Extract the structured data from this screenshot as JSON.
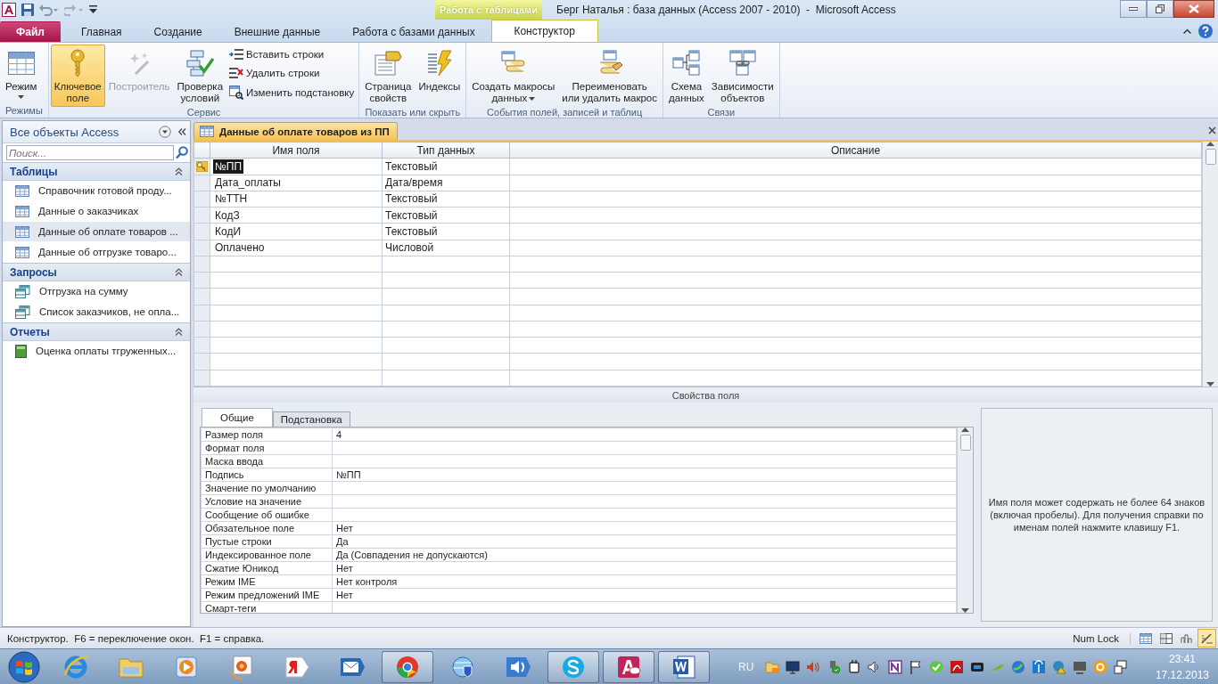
{
  "window": {
    "title": "Берг Наталья : база данных (Access 2007 - 2010)  -  Microsoft Access",
    "contextual_group": "Работа с таблицами"
  },
  "ribbon_tabs": [
    {
      "label": "Файл",
      "kind": "file",
      "selected": false
    },
    {
      "label": "Главная",
      "kind": "tab",
      "selected": false
    },
    {
      "label": "Создание",
      "kind": "tab",
      "selected": false
    },
    {
      "label": "Внешние данные",
      "kind": "tab",
      "selected": false
    },
    {
      "label": "Работа с базами данных",
      "kind": "tab",
      "selected": false
    },
    {
      "label": "Конструктор",
      "kind": "tab",
      "selected": true
    }
  ],
  "ribbon_groups": [
    {
      "label": "Режимы",
      "buttons": [
        {
          "label": "Режим",
          "kind": "large",
          "dropdown": true,
          "selected": false,
          "disabled": false
        }
      ]
    },
    {
      "label": "Сервис",
      "buttons": [
        {
          "label": "Ключевое\nполе",
          "kind": "large",
          "dropdown": false,
          "selected": true,
          "disabled": false
        },
        {
          "label": "Построитель",
          "kind": "large",
          "dropdown": false,
          "selected": false,
          "disabled": true
        },
        {
          "label": "Проверка\nусловий",
          "kind": "large",
          "dropdown": false,
          "selected": false,
          "disabled": false
        },
        {
          "label": "Вставить строки",
          "kind": "small",
          "dropdown": false,
          "selected": false,
          "disabled": false
        },
        {
          "label": "Удалить строки",
          "kind": "small",
          "dropdown": false,
          "selected": false,
          "disabled": false
        },
        {
          "label": "Изменить подстановку",
          "kind": "small",
          "dropdown": false,
          "selected": false,
          "disabled": false
        }
      ]
    },
    {
      "label": "Показать или скрыть",
      "buttons": [
        {
          "label": "Страница\nсвойств",
          "kind": "large",
          "dropdown": false,
          "selected": false,
          "disabled": false
        },
        {
          "label": "Индексы",
          "kind": "large",
          "dropdown": false,
          "selected": false,
          "disabled": false
        }
      ]
    },
    {
      "label": "События полей, записей и таблиц",
      "buttons": [
        {
          "label": "Создать макросы\nданных",
          "kind": "large",
          "dropdown": true,
          "selected": false,
          "disabled": false
        },
        {
          "label": "Переименовать\nили удалить макрос",
          "kind": "large",
          "dropdown": false,
          "selected": false,
          "disabled": false
        }
      ]
    },
    {
      "label": "Связи",
      "buttons": [
        {
          "label": "Схема\nданных",
          "kind": "large",
          "dropdown": false,
          "selected": false,
          "disabled": false
        },
        {
          "label": "Зависимости\nобъектов",
          "kind": "large",
          "dropdown": false,
          "selected": false,
          "disabled": false
        }
      ]
    }
  ],
  "navigation": {
    "title": "Все объекты Access",
    "search": {
      "placeholder": "Поиск..."
    },
    "sections": [
      {
        "label": "Таблицы",
        "expanded": true,
        "items": [
          {
            "label": "Справочник готовой проду...",
            "kind": "table",
            "selected": false
          },
          {
            "label": "Данные о заказчиках",
            "kind": "table",
            "selected": false
          },
          {
            "label": "Данные об оплате товаров ...",
            "kind": "table",
            "selected": true
          },
          {
            "label": "Данные об отгрузке товаро...",
            "kind": "table",
            "selected": false
          }
        ]
      },
      {
        "label": "Запросы",
        "expanded": true,
        "items": [
          {
            "label": "Отгрузка на сумму",
            "kind": "query",
            "selected": false
          },
          {
            "label": "Список заказчиков, не опла...",
            "kind": "query",
            "selected": false
          }
        ]
      },
      {
        "label": "Отчеты",
        "expanded": true,
        "items": [
          {
            "label": "Оценка оплаты тгруженных...",
            "kind": "report",
            "selected": false
          }
        ]
      }
    ]
  },
  "document_tab": {
    "label": "Данные об оплате товаров из ПП"
  },
  "design_grid": {
    "columns": [
      "Имя поля",
      "Тип данных",
      "Описание"
    ],
    "rows": [
      {
        "name": "№ПП",
        "type": "Текстовый",
        "primary_key": true,
        "selected": true
      },
      {
        "name": "Дата_оплаты",
        "type": "Дата/время",
        "primary_key": false,
        "selected": false
      },
      {
        "name": "№ТТН",
        "type": "Текстовый",
        "primary_key": false,
        "selected": false
      },
      {
        "name": "КодЗ",
        "type": "Текстовый",
        "primary_key": false,
        "selected": false
      },
      {
        "name": "КодИ",
        "type": "Текстовый",
        "primary_key": false,
        "selected": false
      },
      {
        "name": "Оплачено",
        "type": "Числовой",
        "primary_key": false,
        "selected": false
      }
    ]
  },
  "field_properties": {
    "title": "Свойства поля",
    "tabs": [
      {
        "label": "Общие",
        "selected": true
      },
      {
        "label": "Подстановка",
        "selected": false
      }
    ],
    "rows": [
      {
        "label": "Размер поля",
        "value": "4"
      },
      {
        "label": "Формат поля"
      },
      {
        "label": "Маска ввода"
      },
      {
        "label": "Подпись",
        "value": "№ПП"
      },
      {
        "label": "Значение по умолчанию"
      },
      {
        "label": "Условие на значение"
      },
      {
        "label": "Сообщение об ошибке"
      },
      {
        "label": "Обязательное поле",
        "value": "Нет"
      },
      {
        "label": "Пустые строки",
        "value": "Да"
      },
      {
        "label": "Индексированное поле",
        "value": "Да (Совпадения не допускаются)"
      },
      {
        "label": "Сжатие Юникод",
        "value": "Нет"
      },
      {
        "label": "Режим IME",
        "value": "Нет контроля"
      },
      {
        "label": "Режим предложений IME",
        "value": "Нет"
      },
      {
        "label": "Смарт-теги"
      }
    ],
    "help": "Имя поля может содержать не более 64 знаков (включая пробелы). Для получения справки по именам полей нажмите клавишу F1."
  },
  "status_bar": {
    "text": "Конструктор.  F6 = переключение окон.  F1 = справка.",
    "indicator": "Num Lock",
    "views": [
      {
        "selected": false
      },
      {
        "selected": false
      },
      {
        "selected": false
      },
      {
        "selected": true
      }
    ]
  },
  "taskbar": {
    "apps": [
      {
        "running": false
      },
      {
        "running": false
      },
      {
        "running": false
      },
      {
        "running": false
      },
      {
        "running": false
      },
      {
        "running": false
      },
      {
        "running": true
      },
      {
        "running": false
      },
      {
        "running": false
      },
      {
        "running": true
      },
      {
        "running": true
      },
      {
        "running": true
      }
    ],
    "language": "RU",
    "time": "23:41",
    "date": "17.12.2013"
  }
}
